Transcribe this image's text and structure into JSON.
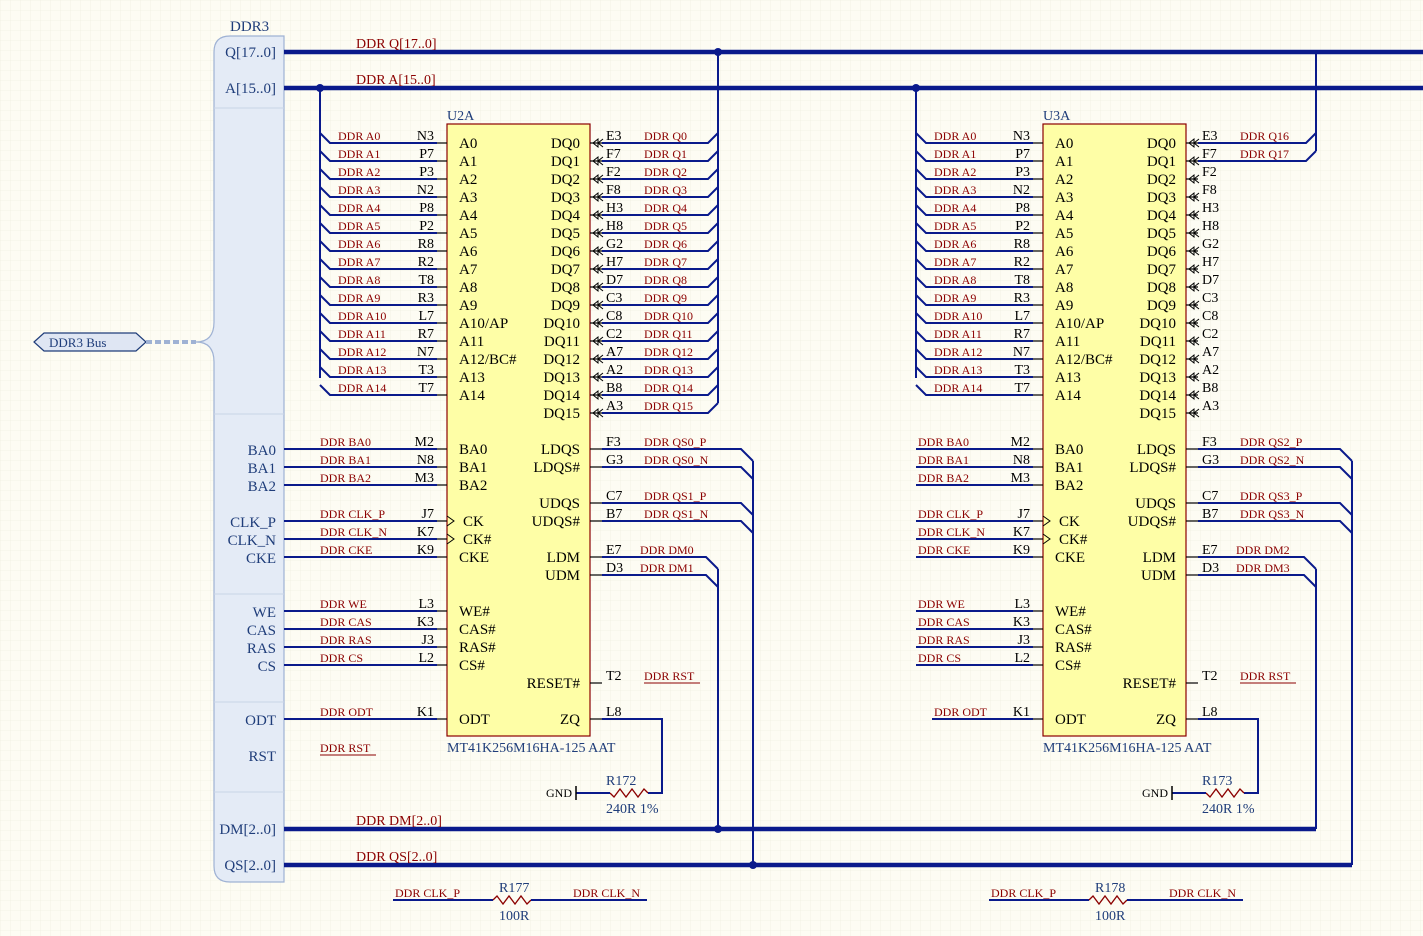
{
  "harness": {
    "name": "DDR3",
    "bus_port": "DDR3 Bus",
    "entries": [
      "Q[17..0]",
      "A[15..0]",
      "BA0",
      "BA1",
      "BA2",
      "CLK_P",
      "CLK_N",
      "CKE",
      "WE",
      "CAS",
      "RAS",
      "CS",
      "ODT",
      "RST",
      "DM[2..0]",
      "QS[2..0]"
    ]
  },
  "buses": {
    "q": "DDR Q[17..0]",
    "a": "DDR A[15..0]",
    "dm": "DDR DM[2..0]",
    "qs": "DDR QS[2..0]"
  },
  "chips": [
    {
      "designator": "U2A",
      "part": "MT41K256M16HA-125 AAT",
      "left_pins": [
        {
          "name": "A0",
          "num": "N3",
          "net": "DDR A0"
        },
        {
          "name": "A1",
          "num": "P7",
          "net": "DDR A1"
        },
        {
          "name": "A2",
          "num": "P3",
          "net": "DDR A2"
        },
        {
          "name": "A3",
          "num": "N2",
          "net": "DDR A3"
        },
        {
          "name": "A4",
          "num": "P8",
          "net": "DDR A4"
        },
        {
          "name": "A5",
          "num": "P2",
          "net": "DDR A5"
        },
        {
          "name": "A6",
          "num": "R8",
          "net": "DDR A6"
        },
        {
          "name": "A7",
          "num": "R2",
          "net": "DDR A7"
        },
        {
          "name": "A8",
          "num": "T8",
          "net": "DDR A8"
        },
        {
          "name": "A9",
          "num": "R3",
          "net": "DDR A9"
        },
        {
          "name": "A10/AP",
          "num": "L7",
          "net": "DDR A10"
        },
        {
          "name": "A11",
          "num": "R7",
          "net": "DDR A11"
        },
        {
          "name": "A12/BC#",
          "num": "N7",
          "net": "DDR A12"
        },
        {
          "name": "A13",
          "num": "T3",
          "net": "DDR A13"
        },
        {
          "name": "A14",
          "num": "T7",
          "net": "DDR A14"
        }
      ],
      "ctrl_pins": [
        {
          "name": "BA0",
          "num": "M2",
          "net": "DDR BA0"
        },
        {
          "name": "BA1",
          "num": "N8",
          "net": "DDR BA1"
        },
        {
          "name": "BA2",
          "num": "M3",
          "net": "DDR BA2"
        },
        {
          "name": "CK",
          "num": "J7",
          "net": "DDR CLK_P"
        },
        {
          "name": "CK#",
          "num": "K7",
          "net": "DDR CLK_N"
        },
        {
          "name": "CKE",
          "num": "K9",
          "net": "DDR CKE"
        },
        {
          "name": "WE#",
          "num": "L3",
          "net": "DDR WE"
        },
        {
          "name": "CAS#",
          "num": "K3",
          "net": "DDR CAS"
        },
        {
          "name": "RAS#",
          "num": "J3",
          "net": "DDR RAS"
        },
        {
          "name": "CS#",
          "num": "L2",
          "net": "DDR CS"
        },
        {
          "name": "ODT",
          "num": "K1",
          "net": "DDR ODT"
        }
      ],
      "right_pins": [
        {
          "name": "DQ0",
          "num": "E3",
          "net": "DDR Q0"
        },
        {
          "name": "DQ1",
          "num": "F7",
          "net": "DDR Q1"
        },
        {
          "name": "DQ2",
          "num": "F2",
          "net": "DDR Q2"
        },
        {
          "name": "DQ3",
          "num": "F8",
          "net": "DDR Q3"
        },
        {
          "name": "DQ4",
          "num": "H3",
          "net": "DDR Q4"
        },
        {
          "name": "DQ5",
          "num": "H8",
          "net": "DDR Q5"
        },
        {
          "name": "DQ6",
          "num": "G2",
          "net": "DDR Q6"
        },
        {
          "name": "DQ7",
          "num": "H7",
          "net": "DDR Q7"
        },
        {
          "name": "DQ8",
          "num": "D7",
          "net": "DDR Q8"
        },
        {
          "name": "DQ9",
          "num": "C3",
          "net": "DDR Q9"
        },
        {
          "name": "DQ10",
          "num": "C8",
          "net": "DDR Q10"
        },
        {
          "name": "DQ11",
          "num": "C2",
          "net": "DDR Q11"
        },
        {
          "name": "DQ12",
          "num": "A7",
          "net": "DDR Q12"
        },
        {
          "name": "DQ13",
          "num": "A2",
          "net": "DDR Q13"
        },
        {
          "name": "DQ14",
          "num": "B8",
          "net": "DDR Q14"
        },
        {
          "name": "DQ15",
          "num": "A3",
          "net": "DDR Q15"
        }
      ],
      "strobe_pins": [
        {
          "name": "LDQS",
          "num": "F3",
          "net": "DDR QS0_P"
        },
        {
          "name": "LDQS#",
          "num": "G3",
          "net": "DDR QS0_N"
        },
        {
          "name": "UDQS",
          "num": "C7",
          "net": "DDR QS1_P"
        },
        {
          "name": "UDQS#",
          "num": "B7",
          "net": "DDR QS1_N"
        },
        {
          "name": "LDM",
          "num": "E7",
          "net": "DDR DM0"
        },
        {
          "name": "UDM",
          "num": "D3",
          "net": "DDR DM1"
        },
        {
          "name": "RESET#",
          "num": "T2",
          "net": "DDR RST"
        },
        {
          "name": "ZQ",
          "num": "L8",
          "net": ""
        }
      ],
      "zq_res": {
        "ref": "R172",
        "value": "240R 1%",
        "gnd": "GND"
      }
    },
    {
      "designator": "U3A",
      "part": "MT41K256M16HA-125 AAT",
      "left_pins": [
        {
          "name": "A0",
          "num": "N3",
          "net": "DDR A0"
        },
        {
          "name": "A1",
          "num": "P7",
          "net": "DDR A1"
        },
        {
          "name": "A2",
          "num": "P3",
          "net": "DDR A2"
        },
        {
          "name": "A3",
          "num": "N2",
          "net": "DDR A3"
        },
        {
          "name": "A4",
          "num": "P8",
          "net": "DDR A4"
        },
        {
          "name": "A5",
          "num": "P2",
          "net": "DDR A5"
        },
        {
          "name": "A6",
          "num": "R8",
          "net": "DDR A6"
        },
        {
          "name": "A7",
          "num": "R2",
          "net": "DDR A7"
        },
        {
          "name": "A8",
          "num": "T8",
          "net": "DDR A8"
        },
        {
          "name": "A9",
          "num": "R3",
          "net": "DDR A9"
        },
        {
          "name": "A10/AP",
          "num": "L7",
          "net": "DDR A10"
        },
        {
          "name": "A11",
          "num": "R7",
          "net": "DDR A11"
        },
        {
          "name": "A12/BC#",
          "num": "N7",
          "net": "DDR A12"
        },
        {
          "name": "A13",
          "num": "T3",
          "net": "DDR A13"
        },
        {
          "name": "A14",
          "num": "T7",
          "net": "DDR A14"
        }
      ],
      "ctrl_pins": [
        {
          "name": "BA0",
          "num": "M2",
          "net": "DDR BA0"
        },
        {
          "name": "BA1",
          "num": "N8",
          "net": "DDR BA1"
        },
        {
          "name": "BA2",
          "num": "M3",
          "net": "DDR BA2"
        },
        {
          "name": "CK",
          "num": "J7",
          "net": "DDR CLK_P"
        },
        {
          "name": "CK#",
          "num": "K7",
          "net": "DDR CLK_N"
        },
        {
          "name": "CKE",
          "num": "K9",
          "net": "DDR CKE"
        },
        {
          "name": "WE#",
          "num": "L3",
          "net": "DDR WE"
        },
        {
          "name": "CAS#",
          "num": "K3",
          "net": "DDR CAS"
        },
        {
          "name": "RAS#",
          "num": "J3",
          "net": "DDR RAS"
        },
        {
          "name": "CS#",
          "num": "L2",
          "net": "DDR CS"
        },
        {
          "name": "ODT",
          "num": "K1",
          "net": "DDR ODT"
        }
      ],
      "right_pins": [
        {
          "name": "DQ0",
          "num": "E3",
          "net": "DDR Q16"
        },
        {
          "name": "DQ1",
          "num": "F7",
          "net": "DDR Q17"
        },
        {
          "name": "DQ2",
          "num": "F2",
          "net": ""
        },
        {
          "name": "DQ3",
          "num": "F8",
          "net": ""
        },
        {
          "name": "DQ4",
          "num": "H3",
          "net": ""
        },
        {
          "name": "DQ5",
          "num": "H8",
          "net": ""
        },
        {
          "name": "DQ6",
          "num": "G2",
          "net": ""
        },
        {
          "name": "DQ7",
          "num": "H7",
          "net": ""
        },
        {
          "name": "DQ8",
          "num": "D7",
          "net": ""
        },
        {
          "name": "DQ9",
          "num": "C3",
          "net": ""
        },
        {
          "name": "DQ10",
          "num": "C8",
          "net": ""
        },
        {
          "name": "DQ11",
          "num": "C2",
          "net": ""
        },
        {
          "name": "DQ12",
          "num": "A7",
          "net": ""
        },
        {
          "name": "DQ13",
          "num": "A2",
          "net": ""
        },
        {
          "name": "DQ14",
          "num": "B8",
          "net": ""
        },
        {
          "name": "DQ15",
          "num": "A3",
          "net": ""
        }
      ],
      "strobe_pins": [
        {
          "name": "LDQS",
          "num": "F3",
          "net": "DDR QS2_P"
        },
        {
          "name": "LDQS#",
          "num": "G3",
          "net": "DDR QS2_N"
        },
        {
          "name": "UDQS",
          "num": "C7",
          "net": "DDR QS3_P"
        },
        {
          "name": "UDQS#",
          "num": "B7",
          "net": "DDR QS3_N"
        },
        {
          "name": "LDM",
          "num": "E7",
          "net": "DDR DM2"
        },
        {
          "name": "UDM",
          "num": "D3",
          "net": "DDR DM3"
        },
        {
          "name": "RESET#",
          "num": "T2",
          "net": "DDR RST"
        },
        {
          "name": "ZQ",
          "num": "L8",
          "net": ""
        }
      ],
      "zq_res": {
        "ref": "R173",
        "value": "240R 1%",
        "gnd": "GND"
      }
    }
  ],
  "harness_ctrl_nets": [
    "DDR BA0",
    "DDR BA1",
    "DDR BA2",
    "DDR CLK_P",
    "DDR CLK_N",
    "DDR CKE",
    "DDR WE",
    "DDR CAS",
    "DDR RAS",
    "DDR CS",
    "DDR ODT",
    "DDR RST"
  ],
  "clk_terminations": [
    {
      "ref": "R177",
      "value": "100R",
      "left": "DDR CLK_P",
      "right": "DDR CLK_N"
    },
    {
      "ref": "R178",
      "value": "100R",
      "left": "DDR CLK_P",
      "right": "DDR CLK_N"
    }
  ],
  "colors": {
    "bus": "#0a1a8c",
    "net": "#8b0000",
    "chip_fill": "#fefea6",
    "port": "#1f3d7a"
  }
}
